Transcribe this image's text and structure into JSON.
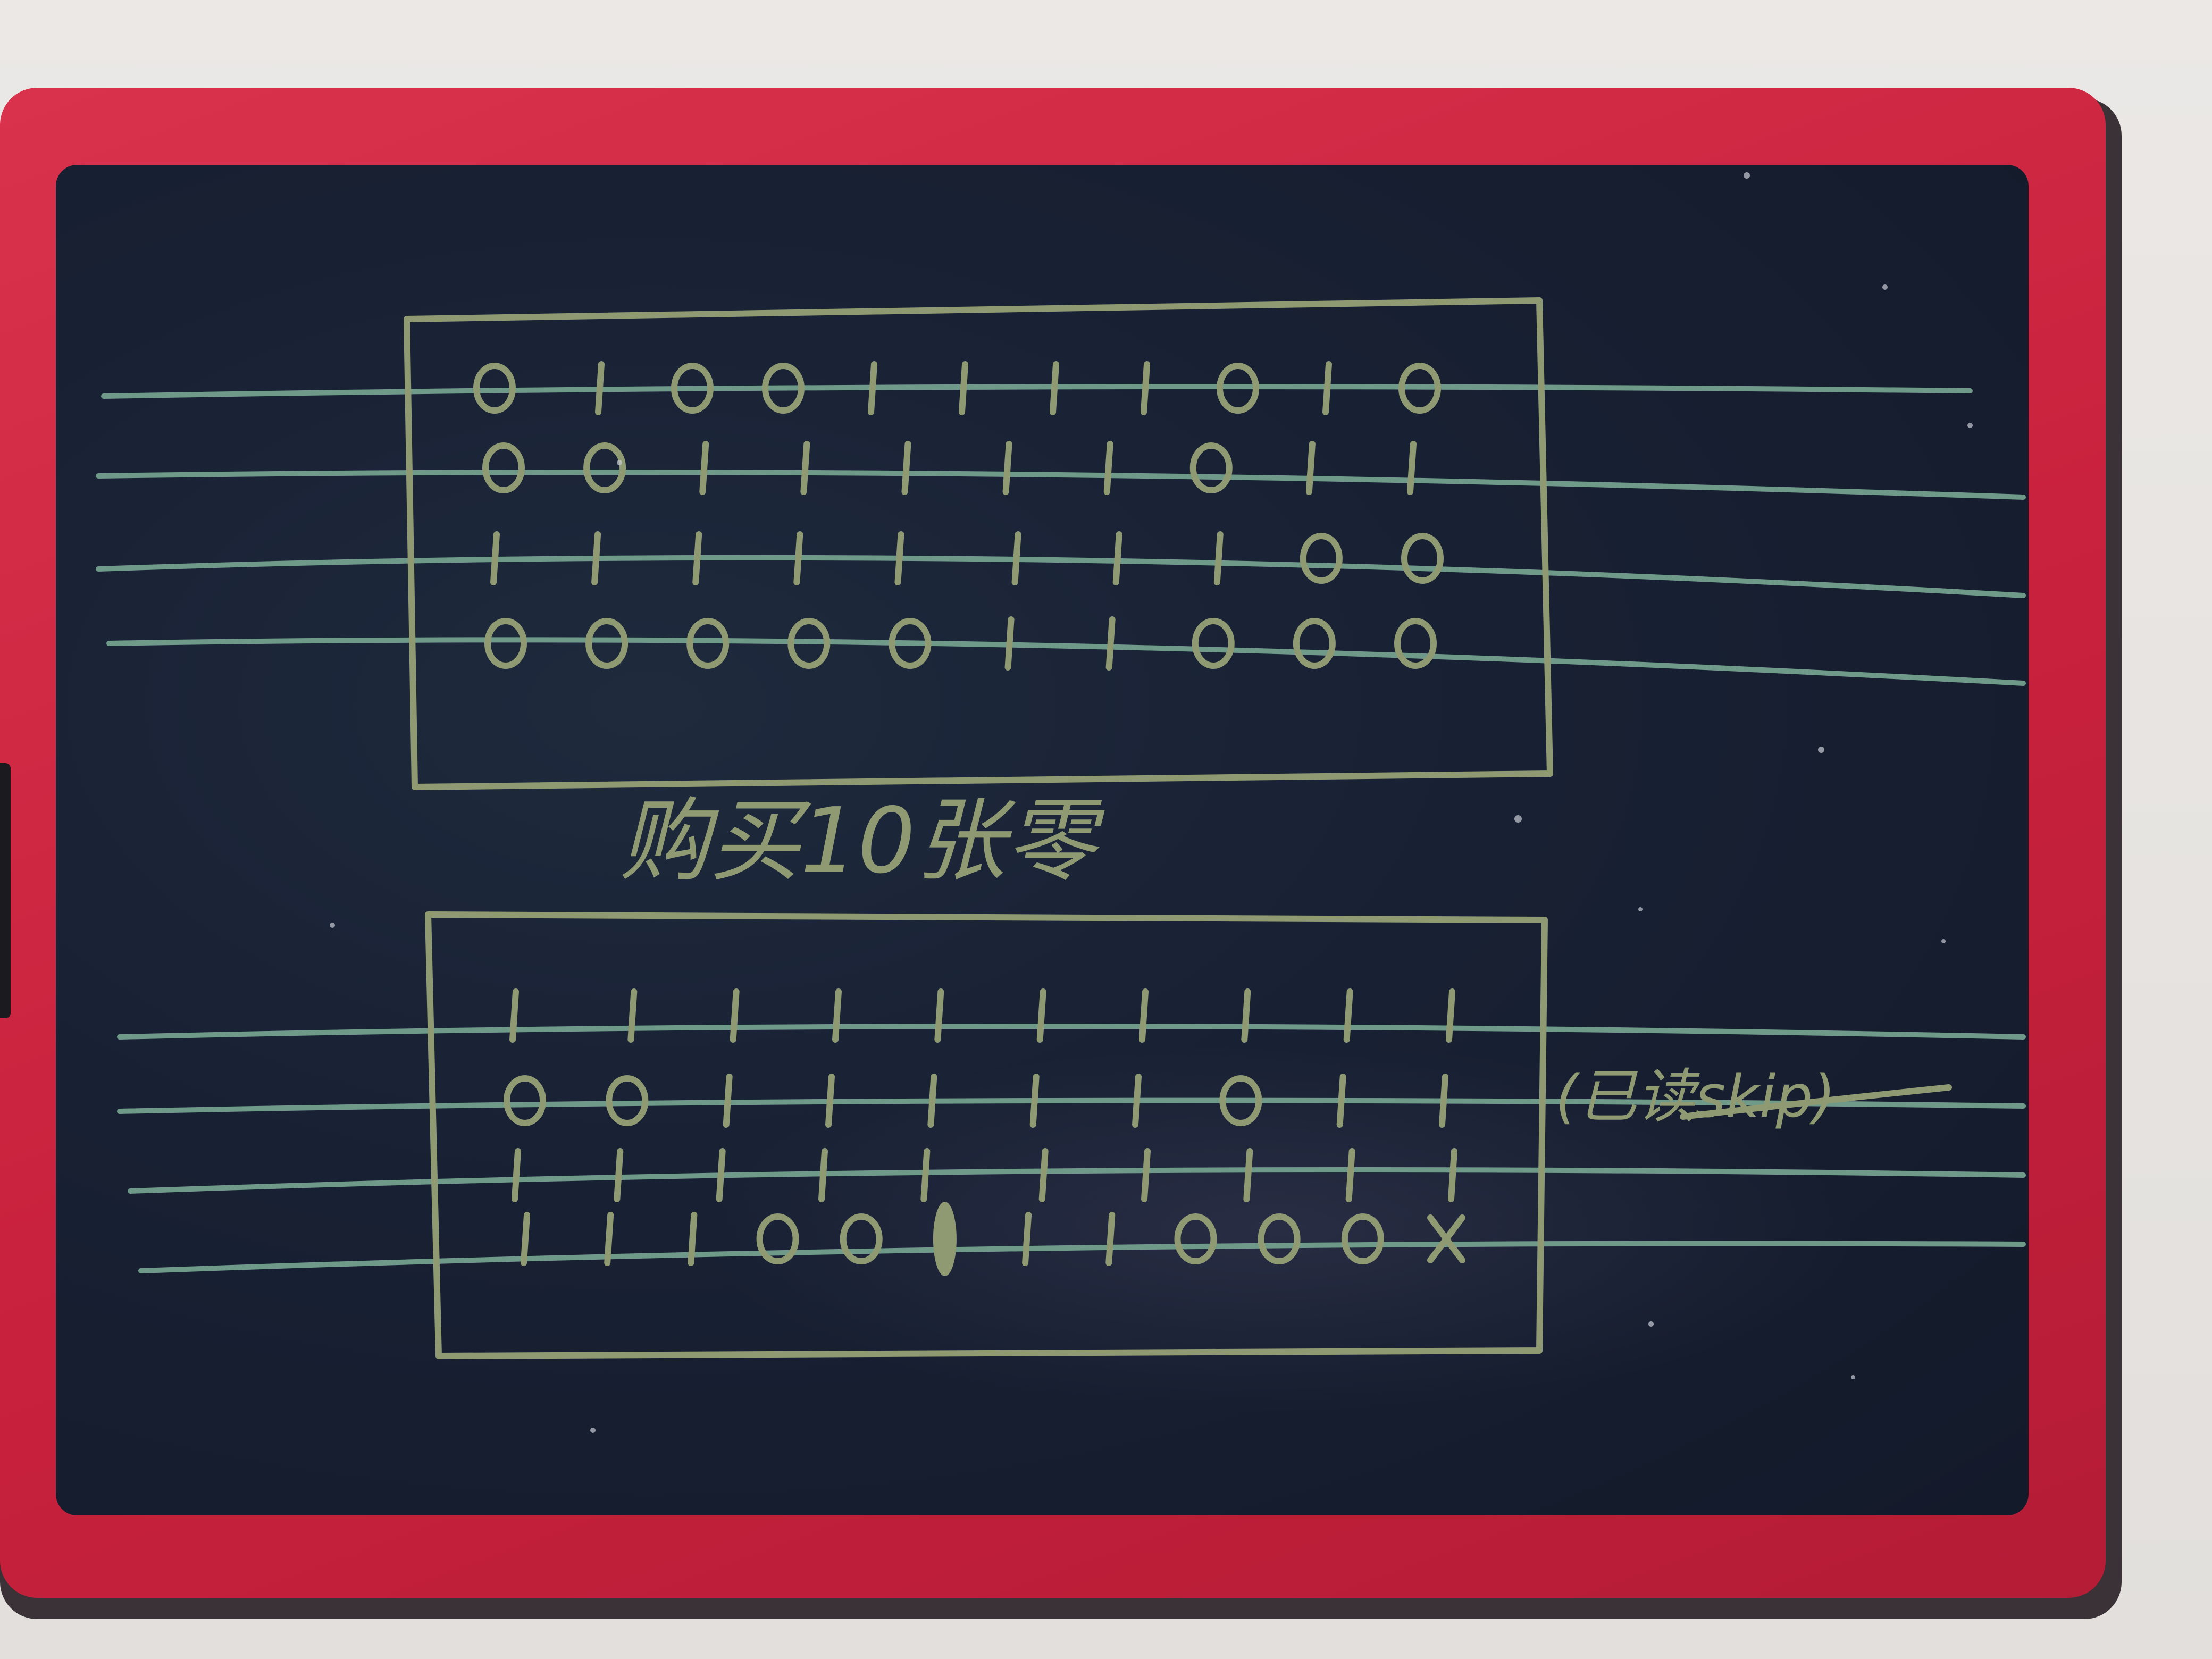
{
  "board": {
    "frame_color": "#c8213d",
    "screen_color": "#182033",
    "ink_color": "#8f9a72"
  },
  "notes": {
    "caption": "购买10张零",
    "side_note": "(已读skip)"
  },
  "tab_top": {
    "rows": [
      [
        "o",
        "|",
        "o",
        "o",
        "|",
        "|",
        "|",
        "|",
        "o",
        "|",
        "o"
      ],
      [
        "o",
        "o",
        "|",
        "|",
        "|",
        "|",
        "|",
        "o",
        "|",
        "|"
      ],
      [
        "|",
        "|",
        "|",
        "|",
        "|",
        "|",
        "|",
        "|",
        "o",
        "o"
      ],
      [
        "o",
        "o",
        "o",
        "o",
        "o",
        "|",
        "|",
        "o",
        "o",
        "o"
      ]
    ]
  },
  "tab_bottom": {
    "rows": [
      [
        "|",
        "|",
        "|",
        "|",
        "|",
        "|",
        "|",
        "|",
        "|",
        "|"
      ],
      [
        "o",
        "o",
        "|",
        "|",
        "|",
        "|",
        "|",
        "o",
        "|",
        "|"
      ],
      [
        "|",
        "|",
        "|",
        "|",
        "|",
        "|",
        "|",
        "|",
        "|",
        "|"
      ],
      [
        "|",
        "|",
        "|",
        "o",
        "o",
        "*",
        "|",
        "|",
        "o",
        "o",
        "o",
        "x"
      ]
    ]
  }
}
